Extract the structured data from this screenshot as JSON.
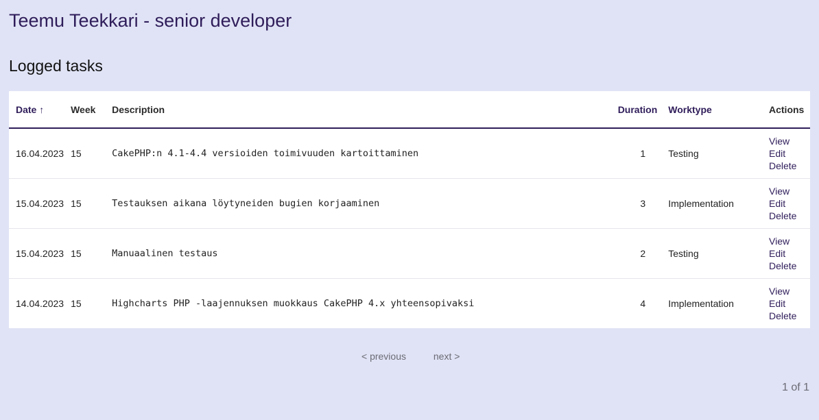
{
  "header": {
    "title": "Teemu Teekkari - senior developer"
  },
  "section": {
    "title": "Logged tasks"
  },
  "table": {
    "columns": {
      "date": "Date",
      "sort_indicator": "↑",
      "week": "Week",
      "description": "Description",
      "duration": "Duration",
      "worktype": "Worktype",
      "actions": "Actions"
    },
    "rows": [
      {
        "date": "16.04.2023",
        "week": "15",
        "description": "CakePHP:n 4.1-4.4 versioiden toimivuuden kartoittaminen",
        "duration": "1",
        "worktype": "Testing"
      },
      {
        "date": "15.04.2023",
        "week": "15",
        "description": "Testauksen aikana löytyneiden bugien korjaaminen",
        "duration": "3",
        "worktype": "Implementation"
      },
      {
        "date": "15.04.2023",
        "week": "15",
        "description": "Manuaalinen testaus",
        "duration": "2",
        "worktype": "Testing"
      },
      {
        "date": "14.04.2023",
        "week": "15",
        "description": "Highcharts PHP -laajennuksen muokkaus CakePHP 4.x yhteensopivaksi",
        "duration": "4",
        "worktype": "Implementation"
      }
    ],
    "action_labels": {
      "view": "View",
      "edit": "Edit",
      "delete": "Delete"
    }
  },
  "pagination": {
    "previous": "< previous",
    "next": "next >",
    "page_count": "1 of 1"
  },
  "colors": {
    "accent": "#2f1d5a",
    "background": "#e0e3f5"
  }
}
